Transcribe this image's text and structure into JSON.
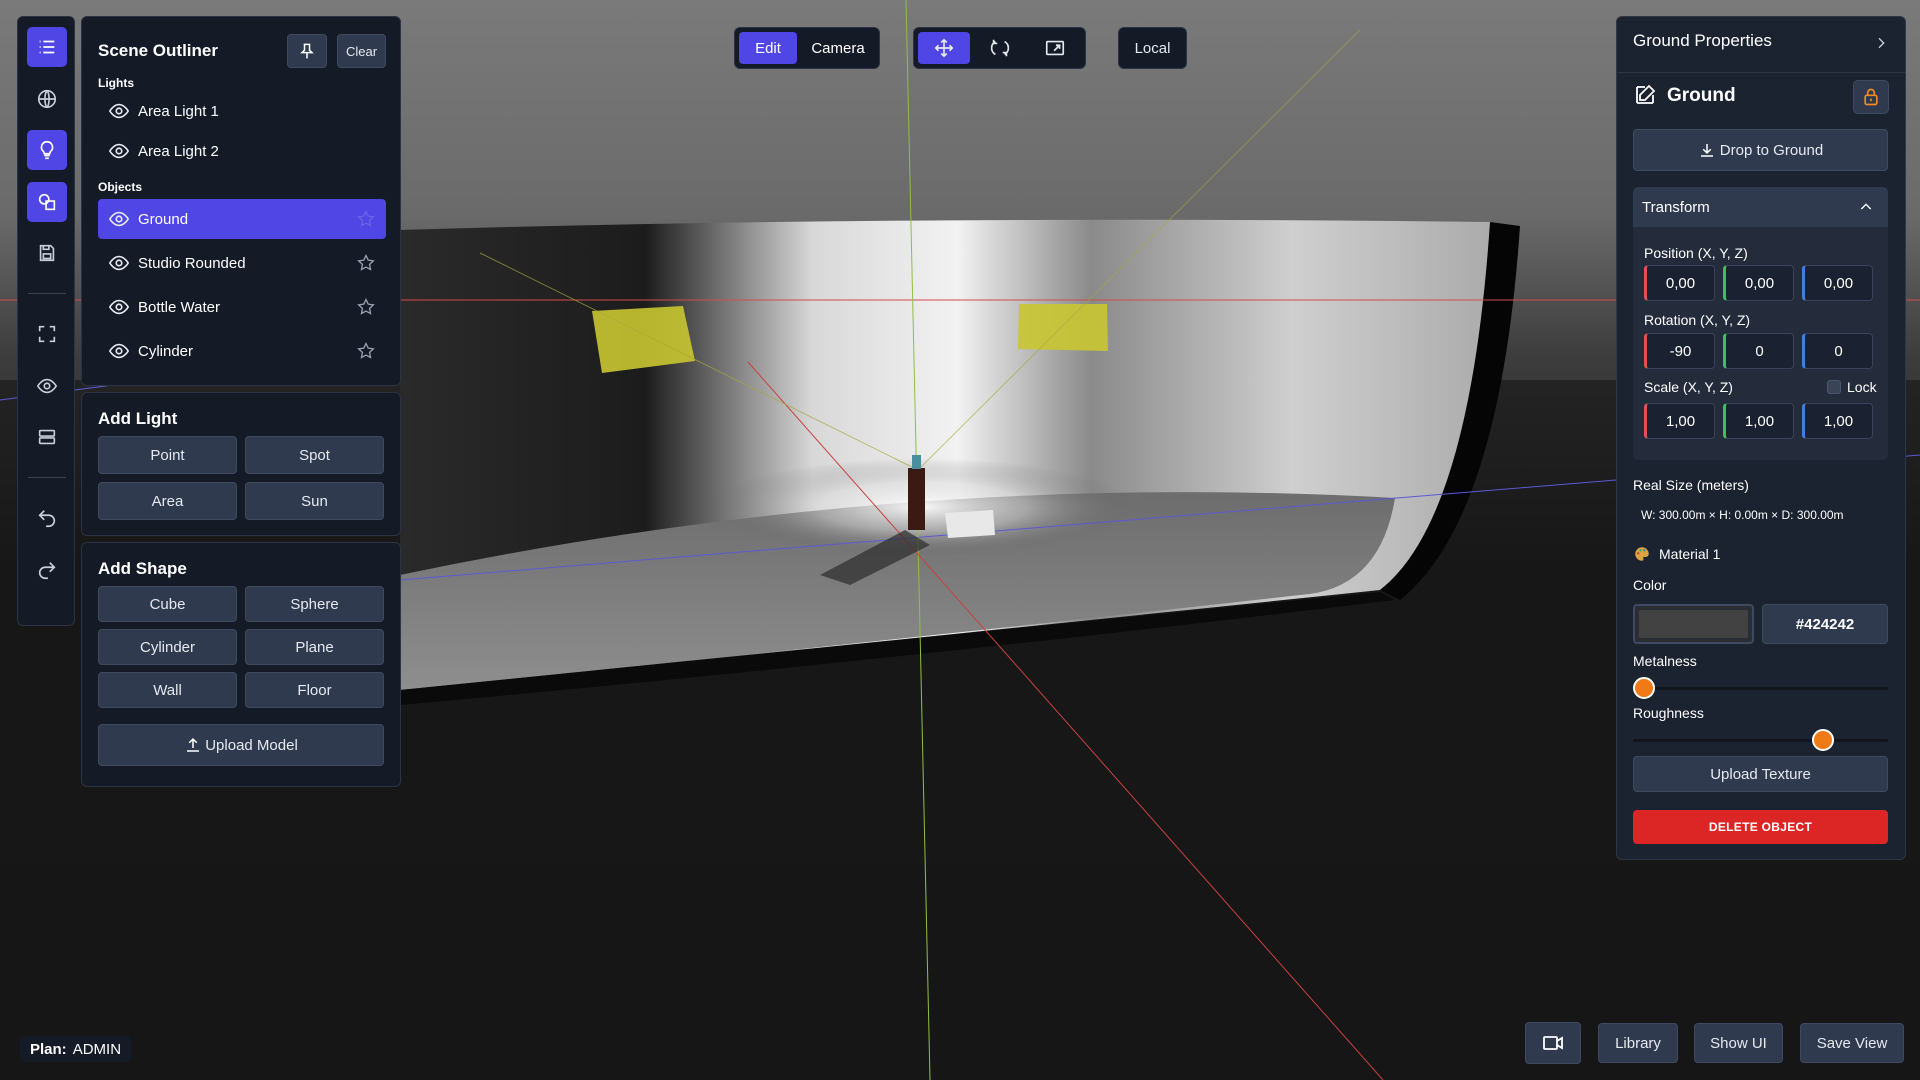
{
  "toolbar": {
    "icons": [
      "list-icon",
      "globe-icon",
      "lightbulb-icon",
      "shapes-icon",
      "save-icon",
      "fullscreen-icon",
      "eye-icon",
      "layers-icon",
      "undo-icon",
      "redo-icon"
    ],
    "active": [
      "list-icon",
      "lightbulb-icon",
      "shapes-icon"
    ]
  },
  "outliner": {
    "title": "Scene Outliner",
    "clear_label": "Clear",
    "lights_label": "Lights",
    "objects_label": "Objects",
    "lights": [
      "Area Light 1",
      "Area Light 2"
    ],
    "objects": [
      "Ground",
      "Studio Rounded",
      "Bottle Water",
      "Cylinder"
    ],
    "selected": "Ground"
  },
  "add_light": {
    "title": "Add Light",
    "buttons": [
      "Point",
      "Spot",
      "Area",
      "Sun"
    ]
  },
  "add_shape": {
    "title": "Add Shape",
    "buttons": [
      "Cube",
      "Sphere",
      "Cylinder",
      "Plane",
      "Wall",
      "Floor"
    ],
    "upload_label": "Upload Model"
  },
  "topbar": {
    "mode_edit": "Edit",
    "mode_camera": "Camera",
    "tools": [
      "move-icon",
      "rotate-icon",
      "scale-icon"
    ],
    "space_label": "Local"
  },
  "properties": {
    "header": "Ground Properties",
    "object_name": "Ground",
    "drop_label": "Drop to Ground",
    "transform_label": "Transform",
    "position_label": "Position (X, Y, Z)",
    "position": [
      "0,00",
      "0,00",
      "0,00"
    ],
    "rotation_label": "Rotation (X, Y, Z)",
    "rotation": [
      "-90",
      "0",
      "0"
    ],
    "scale_label": "Scale (X, Y, Z)",
    "scale": [
      "1,00",
      "1,00",
      "1,00"
    ],
    "lock_label": "Lock",
    "real_size_label": "Real Size (meters)",
    "real_size": "W: 300.00m × H: 0.00m × D: 300.00m",
    "material_label": "Material 1",
    "color_label": "Color",
    "color_hex": "#424242",
    "metalness_label": "Metalness",
    "metalness": 0.0,
    "roughness_label": "Roughness",
    "roughness": 0.77,
    "upload_texture_label": "Upload Texture",
    "delete_label": "DELETE OBJECT"
  },
  "bottom": {
    "plan_key": "Plan:",
    "plan_value": "ADMIN",
    "library_label": "Library",
    "show_ui_label": "Show UI",
    "save_view_label": "Save View"
  },
  "colors": {
    "accent": "#4f46e5",
    "panel": "#141a26",
    "danger": "#dc2626",
    "slider_thumb": "#f07a16",
    "light_panel": "#c9c631"
  }
}
